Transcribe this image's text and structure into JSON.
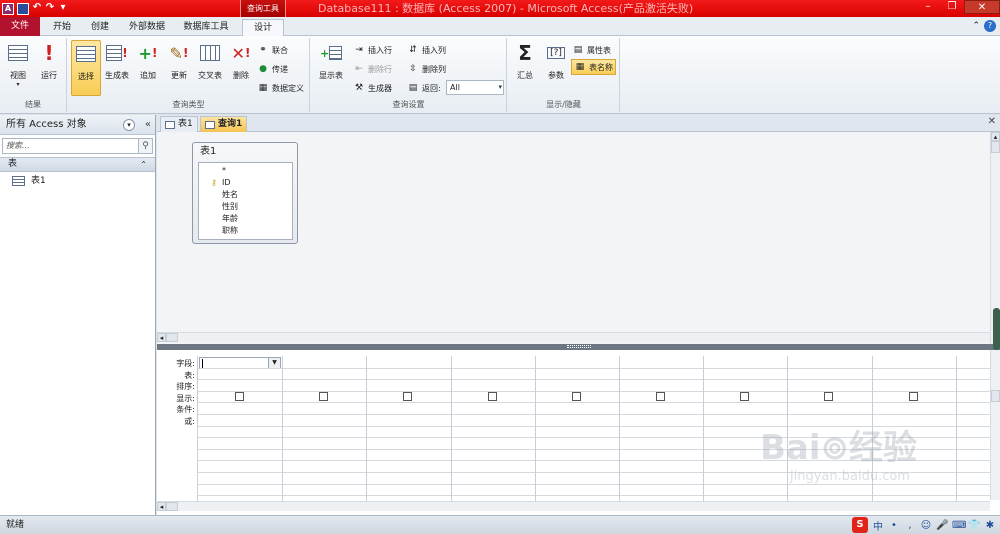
{
  "window": {
    "title": "Database111 : 数据库 (Access 2007) - Microsoft Access(产品激活失败)",
    "context_tool": "查询工具"
  },
  "qat": {
    "app_icon": "A",
    "undo": "↶",
    "redo": "↷",
    "more": "▾"
  },
  "tabs": {
    "file": "文件",
    "home": "开始",
    "create": "创建",
    "external": "外部数据",
    "dbtools": "数据库工具",
    "design": "设计"
  },
  "ribbon": {
    "results": {
      "view": "视图",
      "run": "运行",
      "label": "结果"
    },
    "querytype": {
      "select": "选择",
      "maketable": "生成表",
      "append": "追加",
      "update": "更新",
      "crosstab": "交叉表",
      "delete": "删除",
      "union": "联合",
      "passthrough": "传递",
      "datadef": "数据定义",
      "label": "查询类型"
    },
    "setup": {
      "showtable": "显示表",
      "insertrows": "插入行",
      "deleterows": "删除行",
      "builder": "生成器",
      "insertcols": "插入列",
      "deletecols": "删除列",
      "return_label": "返回:",
      "return_value": "All",
      "label": "查询设置"
    },
    "showhide": {
      "totals": "汇总",
      "params": "参数",
      "propsheet": "属性表",
      "tablenames": "表名称",
      "label": "显示/隐藏"
    }
  },
  "nav": {
    "header": "所有 Access 对象",
    "search_placeholder": "搜索...",
    "group": "表",
    "items": [
      "表1"
    ]
  },
  "doctabs": [
    "表1",
    "查询1"
  ],
  "tablebox": {
    "title": "表1",
    "fields": [
      "*",
      "ID",
      "姓名",
      "性别",
      "年龄",
      "职称"
    ]
  },
  "grid": {
    "row_labels": [
      "字段:",
      "表:",
      "排序:",
      "显示:",
      "条件:",
      "或:"
    ]
  },
  "watermark": {
    "brand": "Bai⊚经验",
    "url": "jingyan.baidu.com"
  },
  "status": {
    "text": "就绪"
  },
  "tray": [
    "S",
    "中",
    "•",
    ",",
    "☺",
    "🎤",
    "⌨",
    "👕",
    "✱"
  ]
}
